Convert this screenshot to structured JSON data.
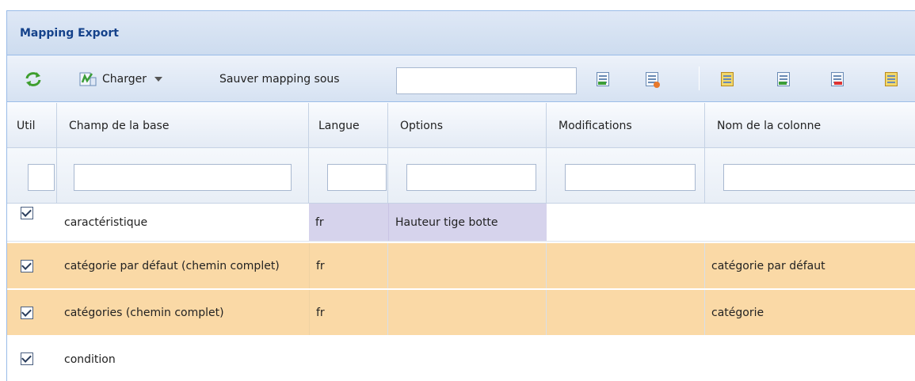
{
  "panel": {
    "title": "Mapping Export"
  },
  "toolbar": {
    "load_label": "Charger",
    "save_as_label": "Sauver mapping sous",
    "save_as_value": ""
  },
  "columns": {
    "use": "Util",
    "field": "Champ de la base",
    "language": "Langue",
    "options": "Options",
    "modifications": "Modifications",
    "column_name": "Nom de la colonne"
  },
  "rows": [
    {
      "checked": true,
      "field": "caractéristique",
      "language": "fr",
      "options": "Hauteur tige botte",
      "modifications": "",
      "column_name": "",
      "highlighted": false
    },
    {
      "checked": true,
      "field": "catégorie par défaut (chemin complet)",
      "language": "fr",
      "options": "",
      "modifications": "",
      "column_name": "catégorie par défaut",
      "highlighted": true
    },
    {
      "checked": true,
      "field": "catégories (chemin complet)",
      "language": "fr",
      "options": "",
      "modifications": "",
      "column_name": "catégorie",
      "highlighted": true
    },
    {
      "checked": true,
      "field": "condition",
      "language": "",
      "options": "",
      "modifications": "",
      "column_name": "",
      "highlighted": false
    }
  ],
  "colors": {
    "header_text": "#15428b",
    "row_highlight": "#fad9a6",
    "language_cell": "#d6d3ec"
  }
}
